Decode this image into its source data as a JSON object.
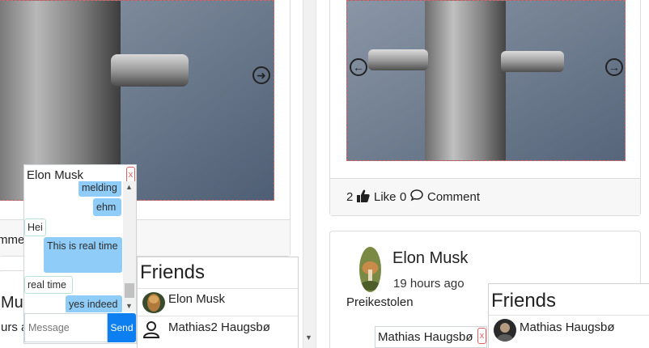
{
  "left_post": {
    "footer_partial": "mme",
    "partial_name": "Mu",
    "partial_time": "urs a"
  },
  "right_post": {
    "like_count": "2",
    "like_label": "Like",
    "comment_count": "0",
    "comment_label": "Comment",
    "author": "Elon Musk",
    "time": "19 hours ago",
    "text": "Preikestolen"
  },
  "chat": {
    "name": "Elon Musk",
    "close_label": "x",
    "messages": [
      {
        "text": "melding",
        "dir": "out"
      },
      {
        "text": "ehm",
        "dir": "out"
      },
      {
        "text": "Hei",
        "dir": "in"
      },
      {
        "text": "This is real time",
        "dir": "out"
      },
      {
        "text": "real time",
        "dir": "in"
      },
      {
        "text": "yes indeed",
        "dir": "out"
      }
    ],
    "placeholder": "Message",
    "send_label": "Send"
  },
  "friends_left": {
    "title": "Friends",
    "items": [
      {
        "name": "Elon Musk"
      },
      {
        "name": "Mathias2 Haugsbø"
      }
    ]
  },
  "chat_tab_right": {
    "name": "Mathias Haugsbø",
    "close_label": "x"
  },
  "friends_right": {
    "title": "Friends",
    "items": [
      {
        "name": "Mathias Haugsbø"
      }
    ]
  },
  "icons": {
    "next": "arrow-right-circle-icon",
    "prev": "arrow-left-circle-icon",
    "like": "thumbs-up-icon",
    "comment": "speech-bubble-icon",
    "user": "person-icon"
  }
}
